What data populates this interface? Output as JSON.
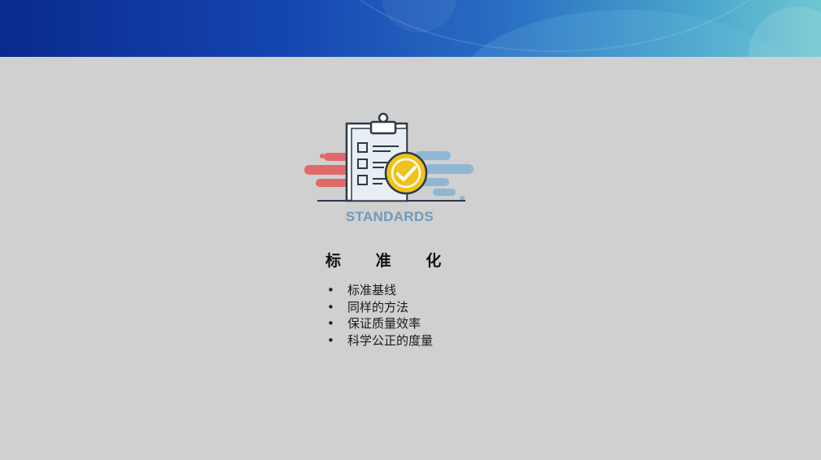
{
  "slide": {
    "illustration_caption": "STANDARDS",
    "title": "标 准 化",
    "bullets": [
      "标准基线",
      "同样的方法",
      "保证质量效率",
      "科学公正的度量"
    ]
  },
  "colors": {
    "background": "#d0d0d0",
    "banner_start": "#0a2a8e",
    "banner_end": "#6cc6d0",
    "check_badge": "#f2c21a",
    "stripe_red": "#e06a6a",
    "stripe_blue": "#8fb7d3",
    "outline": "#2b3a4a"
  },
  "icons": [
    "clipboard-checklist-icon",
    "checkmark-badge-icon"
  ]
}
